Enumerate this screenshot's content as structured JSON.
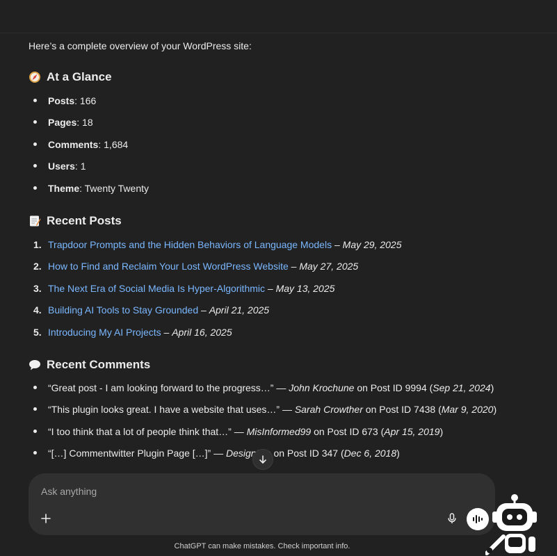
{
  "intro": "Here’s a complete overview of your WordPress site:",
  "glance": {
    "title": "At a Glance",
    "items": [
      {
        "label": "Posts",
        "value": ": 166"
      },
      {
        "label": "Pages",
        "value": ": 18"
      },
      {
        "label": "Comments",
        "value": ": 1,684"
      },
      {
        "label": "Users",
        "value": ": 1"
      },
      {
        "label": "Theme",
        "value": ": Twenty Twenty"
      }
    ]
  },
  "recent_posts": {
    "title": "Recent Posts",
    "items": [
      {
        "num": "1.",
        "title": "Trapdoor Prompts and the Hidden Behaviors of Language Models",
        "sep": " – ",
        "date": "May 29, 2025"
      },
      {
        "num": "2.",
        "title": "How to Find and Reclaim Your Lost WordPress Website",
        "sep": " – ",
        "date": "May 27, 2025"
      },
      {
        "num": "3.",
        "title": "The Next Era of Social Media Is Hyper-Algorithmic",
        "sep": " – ",
        "date": "May 13, 2025"
      },
      {
        "num": "4.",
        "title": "Building AI Tools to Stay Grounded",
        "sep": " – ",
        "date": "April 21, 2025"
      },
      {
        "num": "5.",
        "title": "Introducing My AI Projects",
        "sep": " – ",
        "date": "April 16, 2025"
      }
    ]
  },
  "recent_comments": {
    "title": "Recent Comments",
    "items": [
      {
        "quote": "“Great post - I am looking forward to the progress…” — ",
        "author": "John Krochune",
        "on": " on Post ID 9994 (",
        "date": "Sep 21, 2024",
        "close": ")"
      },
      {
        "quote": "“This plugin looks great. I have a website that uses…” — ",
        "author": "Sarah Crowther",
        "on": " on Post ID 7438 (",
        "date": "Mar 9, 2020",
        "close": ")"
      },
      {
        "quote": "“I too think that a lot of people think that…” — ",
        "author": "MisInformed99",
        "on": " on Post ID 673 (",
        "date": "Apr 15, 2019",
        "close": ")"
      },
      {
        "quote": "“[…] Commentwitter Plugin Page […]” — ",
        "author": "DesignB   p",
        "on": " on Post ID 347 (",
        "date": "Dec 6, 2018",
        "close": ")"
      }
    ]
  },
  "composer": {
    "placeholder": "Ask anything"
  },
  "disclaimer": "ChatGPT can make mistakes. Check important info.",
  "icons": {
    "glance": "compass-icon",
    "posts": "memo-icon",
    "comments": "speech-bubble-icon"
  }
}
